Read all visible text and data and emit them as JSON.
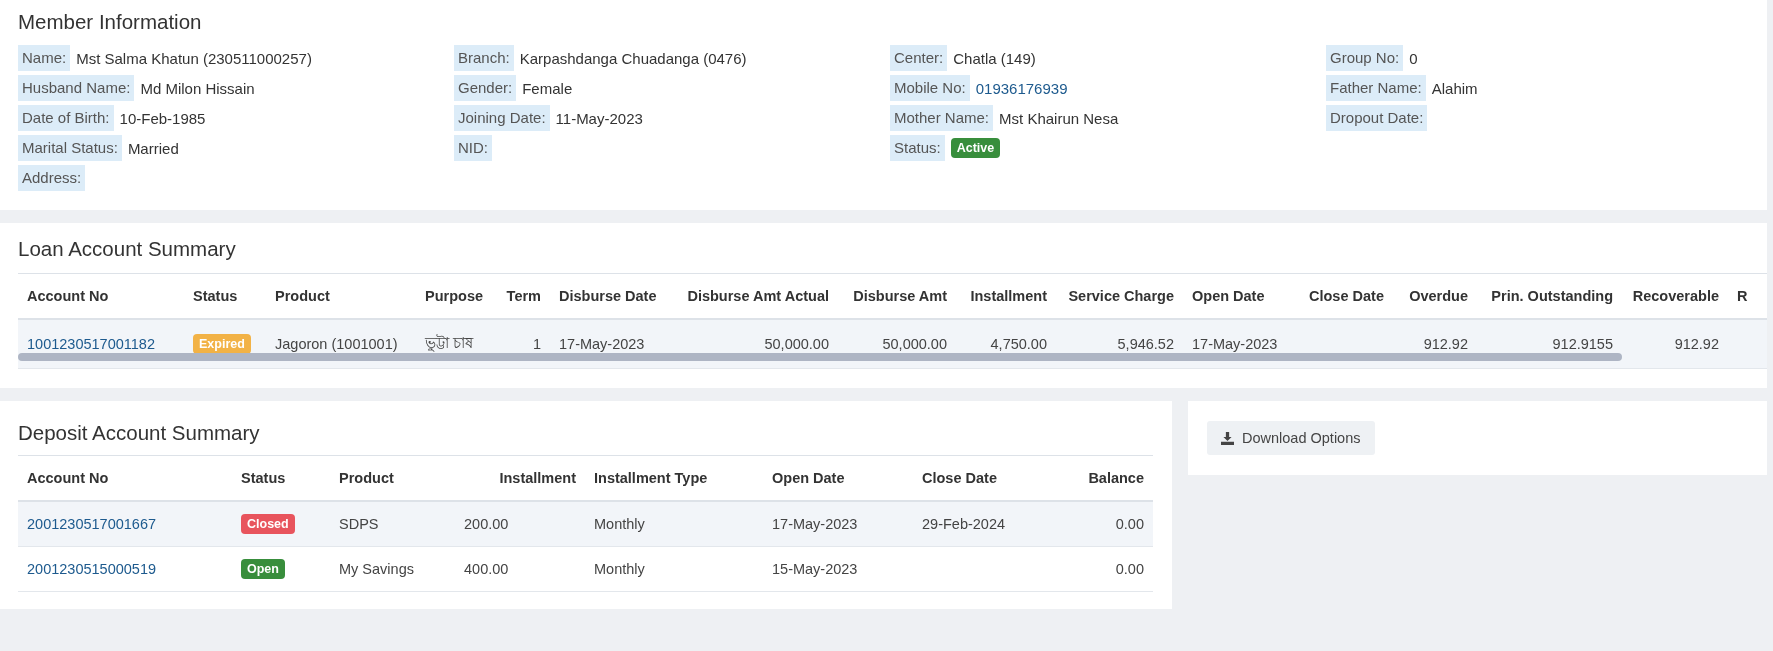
{
  "member_information": {
    "title": "Member Information",
    "columns": [
      [
        {
          "label": "Name:",
          "value": "Mst Salma Khatun (230511000257)",
          "kind": "text"
        },
        {
          "label": "Husband Name:",
          "value": "Md Milon Hissain",
          "kind": "text"
        },
        {
          "label": "Date of Birth:",
          "value": "10-Feb-1985",
          "kind": "text"
        },
        {
          "label": "Marital Status:",
          "value": "Married",
          "kind": "text"
        },
        {
          "label": "Address:"
        }
      ],
      [
        {
          "label": "Branch:",
          "value": "Karpashdanga Chuadanga (0476)",
          "kind": "text"
        },
        {
          "label": "Gender:",
          "value": "Female",
          "kind": "text"
        },
        {
          "label": "Joining Date:",
          "value": "11-May-2023",
          "kind": "text"
        },
        {
          "label": "NID:"
        }
      ],
      [
        {
          "label": "Center:",
          "value": "Chatla (149)",
          "kind": "text"
        },
        {
          "label": "Mobile No:",
          "value": "01936176939",
          "kind": "link"
        },
        {
          "label": "Mother Name:",
          "value": "Mst Khairun Nesa",
          "kind": "text"
        },
        {
          "label": "Status:",
          "value": "Active",
          "kind": "badge",
          "color": "#388e3c"
        }
      ],
      [
        {
          "label": "Group No:",
          "value": "0",
          "kind": "text"
        },
        {
          "label": "Father Name:",
          "value": "Alahim",
          "kind": "text"
        },
        {
          "label": "Dropout Date:"
        }
      ]
    ]
  },
  "loan_account_summary": {
    "title": "Loan Account Summary",
    "columns": [
      "Account No",
      "Status",
      "Product",
      "Purpose",
      "Term",
      "Disburse Date",
      "Disburse Amt Actual",
      "Disburse Amt",
      "Installment",
      "Service Charge",
      "Open Date",
      "Close Date",
      "Overdue",
      "Prin. Outstanding",
      "Recoverable",
      "R"
    ],
    "rows": [
      {
        "account_no": "1001230517001182",
        "status": {
          "label": "Expired",
          "color": "#f2b246"
        },
        "product": "Jagoron (1001001)",
        "purpose": "ভুট্টা চাষ",
        "term": "1",
        "disburse_date": "17-May-2023",
        "disburse_amt_actual": "50,000.00",
        "disburse_amt": "50,000.00",
        "installment": "4,750.00",
        "service_charge": "5,946.52",
        "open_date": "17-May-2023",
        "overdue": "912.92",
        "prin_outstanding": "912.9155",
        "recoverable": "912.92"
      }
    ]
  },
  "deposit_account_summary": {
    "title": "Deposit Account Summary",
    "columns": [
      "Account No",
      "Status",
      "Product",
      "Installment",
      "Installment Type",
      "Open Date",
      "Close Date",
      "Balance"
    ],
    "rows": [
      {
        "account_no": "2001230517001667",
        "status": {
          "label": "Closed",
          "color": "#e8545d"
        },
        "product": "SDPS",
        "installment": "200.00",
        "installment_type": "Monthly",
        "open_date": "17-May-2023",
        "close_date": "29-Feb-2024",
        "balance": "0.00"
      },
      {
        "account_no": "2001230515000519",
        "status": {
          "label": "Open",
          "color": "#388e3c"
        },
        "product": "My Savings",
        "installment": "400.00",
        "installment_type": "Monthly",
        "open_date": "15-May-2023",
        "balance": "0.00"
      }
    ]
  },
  "download_button": {
    "label": "Download Options"
  }
}
